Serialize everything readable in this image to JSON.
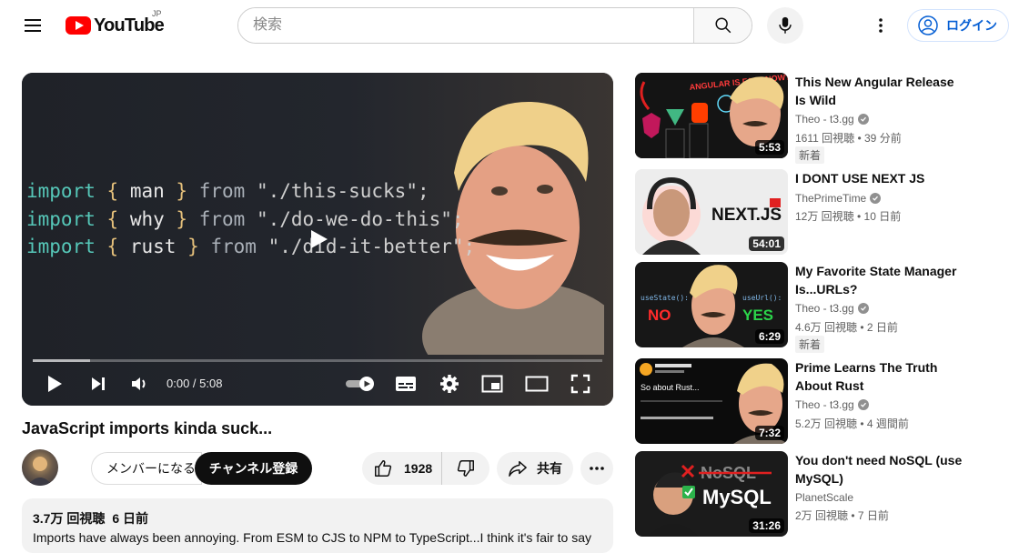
{
  "header": {
    "logo_text": "YouTube",
    "country_code": "JP",
    "search_placeholder": "検索",
    "login_label": "ログイン"
  },
  "player": {
    "code_lines": [
      {
        "kw": "import",
        "ob": "{",
        "id": "man",
        "cb": "}",
        "fr": "from",
        "str": "\"./this-sucks\";"
      },
      {
        "kw": "import",
        "ob": "{",
        "id": "why",
        "cb": "}",
        "fr": "from",
        "str": "\"./do-we-do-this\";"
      },
      {
        "kw": "import",
        "ob": "{",
        "id": "rust",
        "cb": "}",
        "fr": "from",
        "str": "\"./did-it-better\";"
      }
    ],
    "time_current": "0:00",
    "time_total": "5:08",
    "time_display": "0:00 / 5:08",
    "progress": 0.1
  },
  "video": {
    "title": "JavaScript imports kinda suck...",
    "member_label": "メンバーになる",
    "subscribe_label": "チャンネル登録",
    "like_count": "1928",
    "share_label": "共有"
  },
  "description": {
    "views": "3.7万 回視聴",
    "date": "6 日前",
    "text": "Imports have always been annoying. From ESM to CJS to NPM to TypeScript...I think it's fair to say"
  },
  "recommendations": [
    {
      "title": "This New Angular Release Is Wild",
      "channel": "Theo - t3.gg",
      "verified": true,
      "meta": "1611 回視聴 • 39 分前",
      "badge": "新着",
      "duration": "5:53",
      "thumb_text": "ANGULAR IS FAST NOW??"
    },
    {
      "title": "I DONT USE NEXT JS",
      "channel": "ThePrimeTime",
      "verified": true,
      "meta": "12万 回視聴 • 10 日前",
      "badge": "",
      "duration": "54:01",
      "thumb_text": "NEXT.JS"
    },
    {
      "title": "My Favorite State Manager Is...URLs?",
      "channel": "Theo - t3.gg",
      "verified": true,
      "meta": "4.6万 回視聴 • 2 日前",
      "badge": "新着",
      "duration": "6:29",
      "thumb_left_code": "useState():",
      "thumb_left_word": "NO",
      "thumb_right_code": "useUrl():",
      "thumb_right_word": "YES"
    },
    {
      "title": "Prime Learns The Truth About Rust",
      "channel": "Theo - t3.gg",
      "verified": true,
      "meta": "5.2万 回視聴 • 4 週間前",
      "badge": "",
      "duration": "7:32",
      "thumb_text": "So about Rust..."
    },
    {
      "title": "You don't need NoSQL (use MySQL)",
      "channel": "PlanetScale",
      "verified": false,
      "meta": "2万 回視聴 • 7 日前",
      "badge": "",
      "duration": "31:26",
      "thumb_text_top": "NoSQL",
      "thumb_text_bottom": "MySQL"
    }
  ],
  "colors": {
    "brand_red": "#ff0000",
    "link_blue": "#065fd4",
    "subscribe_bg": "#0f0f0f"
  }
}
